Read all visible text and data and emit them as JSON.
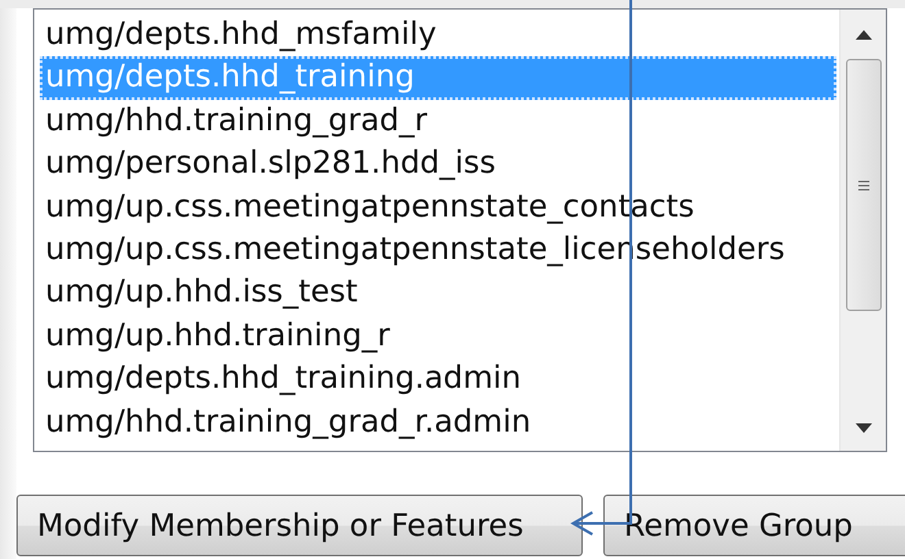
{
  "list": {
    "items": [
      {
        "label": "umg/depts.hhd_msfamily",
        "selected": false
      },
      {
        "label": "umg/depts.hhd_training",
        "selected": true
      },
      {
        "label": "umg/hhd.training_grad_r",
        "selected": false
      },
      {
        "label": "umg/personal.slp281.hdd_iss",
        "selected": false
      },
      {
        "label": "umg/up.css.meetingatpennstate_contacts",
        "selected": false
      },
      {
        "label": "umg/up.css.meetingatpennstate_licenseholders",
        "selected": false
      },
      {
        "label": "umg/up.hhd.iss_test",
        "selected": false
      },
      {
        "label": "umg/up.hhd.training_r",
        "selected": false
      },
      {
        "label": "umg/depts.hhd_training.admin",
        "selected": false
      },
      {
        "label": "umg/hhd.training_grad_r.admin",
        "selected": false
      }
    ]
  },
  "buttons": [
    "Modify Membership or Features",
    "Remove Group"
  ]
}
